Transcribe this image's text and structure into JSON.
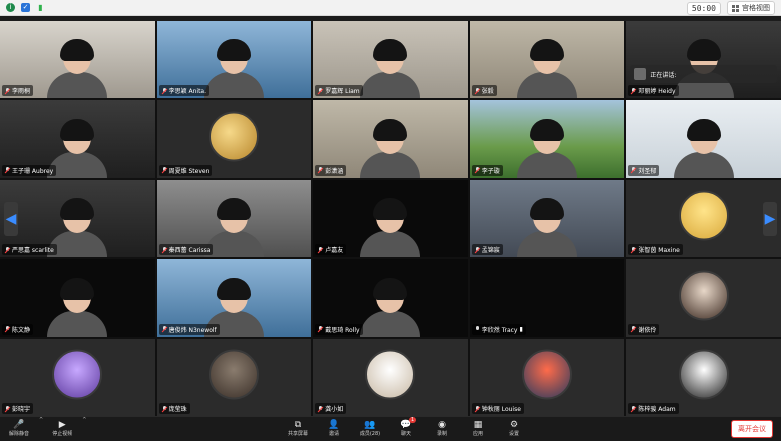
{
  "topbar": {
    "timer": "50:00",
    "view_label": "宫格视图"
  },
  "tiles": [
    {
      "name": "李雨桐",
      "mic": "muted",
      "bg": "bg-room"
    },
    {
      "name": "李思颖 Anita.",
      "mic": "muted",
      "bg": "bg-lab"
    },
    {
      "name": "罗嘉辉 Liam",
      "mic": "muted",
      "bg": "bg-wall"
    },
    {
      "name": "张毅",
      "mic": "muted",
      "bg": "bg-shelf"
    },
    {
      "name": "邓丽婷 Heidy",
      "mic": "muted",
      "bg": "bg-dark"
    },
    {
      "name": "王子珊 Aubrey",
      "mic": "muted",
      "bg": "bg-dark"
    },
    {
      "name": "周夏维 Steven",
      "mic": "muted",
      "bg": "bg-gray"
    },
    {
      "name": "彭潇涵",
      "mic": "muted",
      "bg": "bg-shelf"
    },
    {
      "name": "李子璇",
      "mic": "muted",
      "bg": "bg-green"
    },
    {
      "name": "刘圣郁",
      "mic": "muted",
      "bg": "bg-window"
    },
    {
      "name": "严思嘉 scarlite",
      "mic": "muted",
      "bg": "bg-dark"
    },
    {
      "name": "秦西蕾 Carissa",
      "mic": "muted",
      "bg": "bg-office"
    },
    {
      "name": "卢嘉友",
      "mic": "muted",
      "bg": "bg-black"
    },
    {
      "name": "孟锦宸",
      "mic": "muted",
      "bg": "bg-store"
    },
    {
      "name": "张智茵 Maxine",
      "mic": "muted",
      "bg": "bg-gray"
    },
    {
      "name": "陈文静",
      "mic": "muted",
      "bg": "bg-black"
    },
    {
      "name": "唐俊炜 N3newolf",
      "mic": "muted",
      "bg": "bg-lab"
    },
    {
      "name": "戴思琦 Rolly",
      "mic": "muted",
      "bg": "bg-black"
    },
    {
      "name": "李欣然 Tracy",
      "mic": "on",
      "bg": "bg-black"
    },
    {
      "name": "谢依伶",
      "mic": "muted",
      "bg": "bg-gray"
    },
    {
      "name": "彭晓宇",
      "mic": "muted",
      "bg": "bg-gray"
    },
    {
      "name": "庞莹珠",
      "mic": "muted",
      "bg": "bg-gray"
    },
    {
      "name": "龚小如",
      "mic": "muted",
      "bg": "bg-gray"
    },
    {
      "name": "钟秋丽 Louise",
      "mic": "muted",
      "bg": "bg-gray"
    },
    {
      "name": "陈梓骏 Adam",
      "mic": "muted",
      "bg": "bg-gray"
    }
  ],
  "speaking": {
    "label": "正在讲话:"
  },
  "toolbar": {
    "mute": "解除静音",
    "video": "停止视频",
    "share": "共享屏幕",
    "invite": "邀请",
    "members": "成员(28)",
    "chat": "聊天",
    "chat_badge": "1",
    "record": "录制",
    "apps": "应用",
    "settings": "设置",
    "leave": "离开会议"
  }
}
